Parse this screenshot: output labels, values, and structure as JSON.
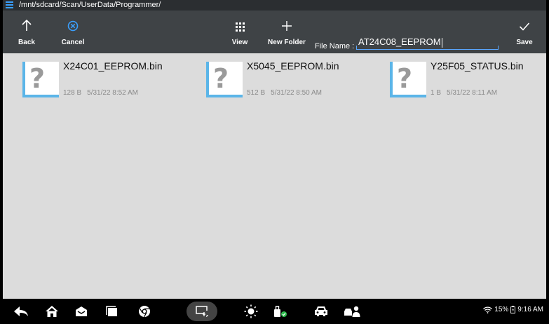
{
  "path": "/mnt/sdcard/Scan/UserData/Programmer/",
  "toolbar": {
    "back": "Back",
    "cancel": "Cancel",
    "view": "View",
    "new_folder": "New Folder",
    "file_name_label": "File Name :",
    "file_name_value": "AT24C08_EEPROM",
    "save": "Save"
  },
  "files": [
    {
      "name": "X24C01_EEPROM.bin",
      "size": "128 B",
      "date": "5/31/22 8:52 AM",
      "icon": "unknown-file-icon"
    },
    {
      "name": "X5045_EEPROM.bin",
      "size": "512 B",
      "date": "5/31/22 8:50 AM",
      "icon": "unknown-file-icon"
    },
    {
      "name": "Y25F05_STATUS.bin",
      "size": "1 B",
      "date": "5/31/22 8:11 AM",
      "icon": "unknown-file-icon"
    }
  ],
  "status": {
    "battery": "15%",
    "time": "9:16 AM"
  },
  "colors": {
    "accent": "#3aa0ff",
    "toolbar_bg": "#3f4346",
    "pathbar_bg": "#2b2e31",
    "content_bg": "#dcdcdc",
    "thumb_border": "#5bb5e8"
  }
}
